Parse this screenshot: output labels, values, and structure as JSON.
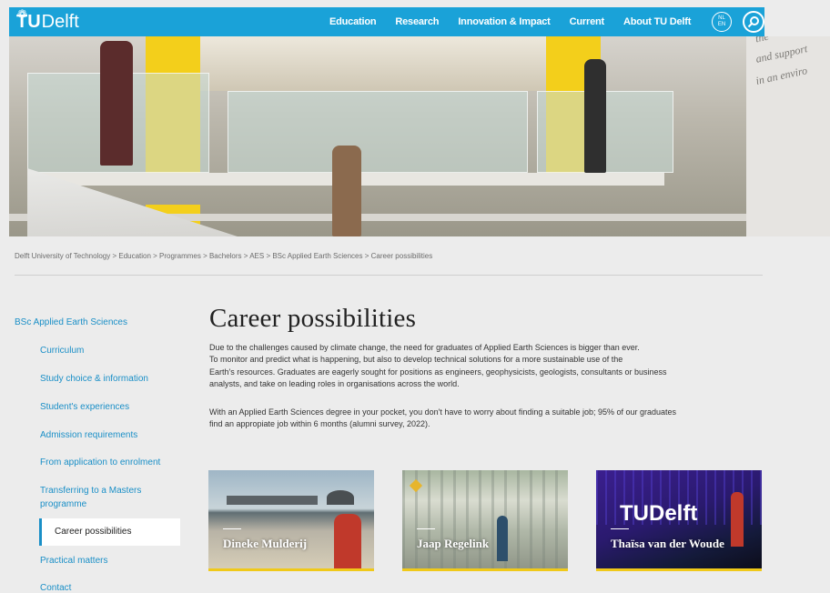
{
  "header": {
    "logo_tu": "TU",
    "logo_delft": "Delft",
    "nav": [
      "Education",
      "Research",
      "Innovation & Impact",
      "Current",
      "About TU Delft"
    ],
    "lang_top": "NL",
    "lang_bottom": "EN",
    "accent_color": "#1aa2d8"
  },
  "hero": {
    "wall_text_1": "and support",
    "wall_text_2": "in an enviro",
    "wall_text_0": "the"
  },
  "breadcrumb": "Delft University of Technology > Education > Programmes > Bachelors > AES > BSc Applied Earth Sciences > Career possibilities",
  "sidebar": {
    "title": "BSc Applied Earth Sciences",
    "items": [
      "Curriculum",
      "Study choice & information",
      "Student's experiences",
      "Admission requirements",
      "From application to enrolment",
      "Transferring to a Masters",
      "programme",
      "Career possibilities",
      "Practical matters",
      "Contact"
    ],
    "active": "Career possibilities"
  },
  "main": {
    "title": "Career possibilities",
    "paragraph_1_lines": [
      "Due to the challenges caused by climate change, the need for graduates of Applied Earth Sciences is bigger than ever.",
      "To monitor and predict what is happening, but also to develop technical solutions for a more sustainable use of the",
      "Earth's resources. Graduates are eagerly sought for positions as engineers, geophysicists, geologists, consultants or business",
      "analysts, and take on leading roles in organisations across the world."
    ],
    "paragraph_2_lines": [
      "With an Applied Earth Sciences degree in your pocket, you don't have to worry about finding a suitable job; 95% of our graduates",
      "find an appropiate job within 6 months (alumni survey, 2022)."
    ],
    "cards": [
      "Dineke Mulderij",
      "Jaap Regelink",
      "Thaïsa van der Woude"
    ],
    "card3_logo": "TUDelft"
  }
}
